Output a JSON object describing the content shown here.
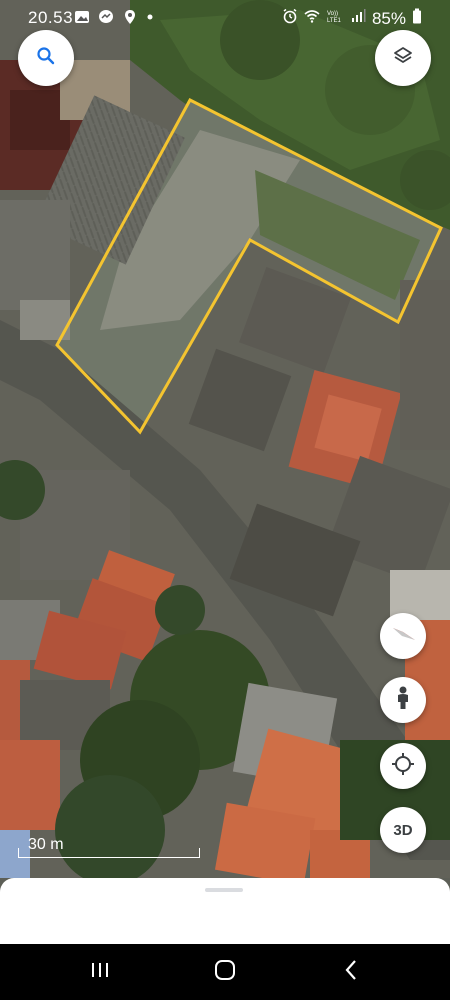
{
  "status_bar": {
    "time": "20.53",
    "battery_percent": "85%",
    "left_icons": [
      "gallery-icon",
      "messenger-icon",
      "location-icon",
      "dot-icon"
    ],
    "right_icons": [
      "alarm-icon",
      "wifi-icon",
      "volte-icon",
      "signal-icon",
      "battery-icon"
    ]
  },
  "map": {
    "type": "satellite",
    "scale_label": "30 m",
    "boundary_color": "#f4c430"
  },
  "controls": {
    "search_icon": "search-icon",
    "layers_icon": "layers-icon",
    "compass_icon": "compass-icon",
    "street_view_icon": "pegman-icon",
    "my_location_icon": "my-location-icon",
    "three_d_label": "3D"
  },
  "navigation_bar": {
    "buttons": [
      "recent-apps-icon",
      "home-icon",
      "back-icon"
    ]
  }
}
